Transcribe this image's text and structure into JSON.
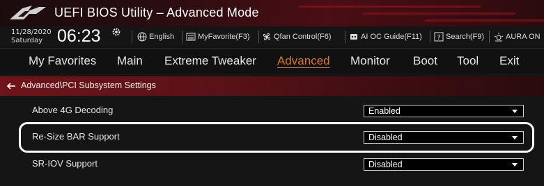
{
  "titlebar": {
    "title": "UEFI BIOS Utility – Advanced Mode",
    "accent": "#8a121b"
  },
  "infobar": {
    "date": "11/28/2020",
    "day": "Saturday",
    "time": "06:23",
    "tools": [
      {
        "label": "English",
        "icon": "globe-icon"
      },
      {
        "label": "MyFavorite(F3)",
        "icon": "favorite-list-icon"
      },
      {
        "label": "Qfan Control(F6)",
        "icon": "fan-icon"
      },
      {
        "label": "AI OC Guide(F11)",
        "icon": "ai-chip-icon"
      },
      {
        "label": "Search(F9)",
        "icon": "question-search-icon"
      },
      {
        "label": "AURA ON",
        "icon": "aura-light-icon"
      }
    ]
  },
  "nav": {
    "tabs": [
      "My Favorites",
      "Main",
      "Extreme Tweaker",
      "Advanced",
      "Monitor",
      "Boot",
      "Tool",
      "Exit"
    ],
    "active": "Advanced",
    "active_color": "#d7761f"
  },
  "breadcrumb": {
    "text": "Advanced\\PCI Subsystem Settings",
    "icon": "back-arrow-icon"
  },
  "settings": [
    {
      "label": "Above 4G Decoding",
      "value": "Enabled"
    },
    {
      "label": "Re-Size BAR Support",
      "value": "Disabled"
    },
    {
      "label": "SR-IOV Support",
      "value": "Disabled"
    }
  ]
}
